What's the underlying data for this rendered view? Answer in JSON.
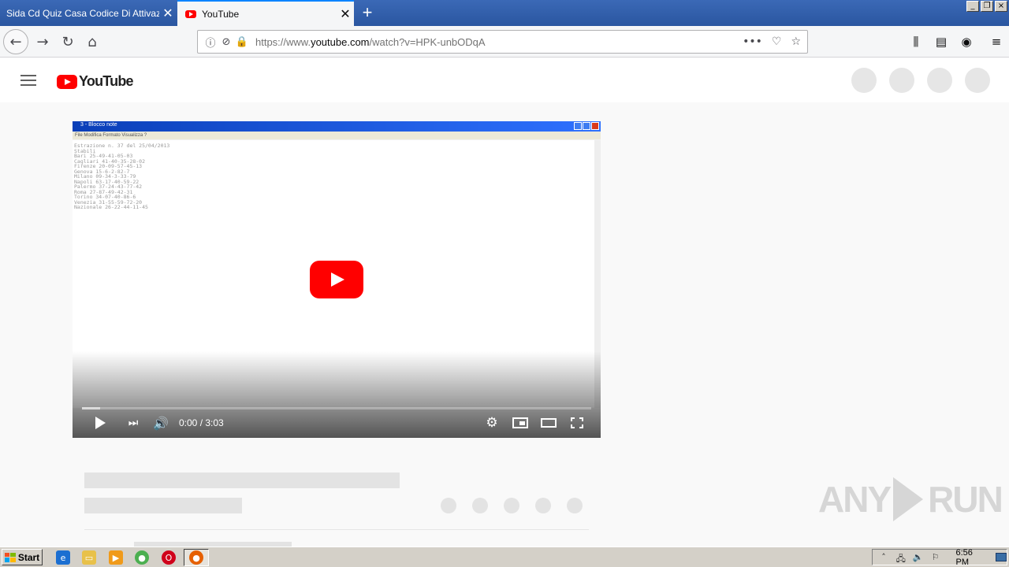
{
  "browser": {
    "tabs": [
      {
        "title": "Sida Cd Quiz Casa Codice Di Attivazione",
        "active": false
      },
      {
        "title": "YouTube",
        "active": true
      }
    ],
    "new_tab_icon": "plus-icon",
    "url_prefix": "https://www.",
    "url_domain": "youtube.com",
    "url_path": "/watch?v=HPK-unbODqA",
    "window_buttons": {
      "minimize": "_",
      "restore": "❐",
      "close": "×"
    }
  },
  "youtube": {
    "logo_text": "YouTube",
    "brand_color": "#ff0000"
  },
  "player": {
    "embedded_window_title": "3 - Blocco note",
    "embedded_menu": "File   Modifica   Formato   Visualizza   ?",
    "embedded_lines": [
      "Estrazione n. 37 del 25/04/2013",
      "Stabili",
      "Bari 25-49-41-05-03",
      "Cagliari 41-40-35-28-02",
      "Firenze 20-09-57-45-13",
      "Genova 15-6-2-82-7",
      "Milano 09-34-3-33-79",
      "Napoli 63-17-40-59-22",
      "Palermo 37-24-43-77-42",
      "Roma 27-87-49-42-31",
      "Torino 34-07-40-86-6",
      "Venezia 31-55-59-72-20",
      "Nazionale 26-22-44-11-45"
    ],
    "time_display": "0:00 / 3:03",
    "progress_loaded_fraction": 0.035
  },
  "watermark": {
    "text_left": "ANY",
    "text_right": "RUN"
  },
  "taskbar": {
    "start_label": "Start",
    "clock": "6:56 PM"
  }
}
